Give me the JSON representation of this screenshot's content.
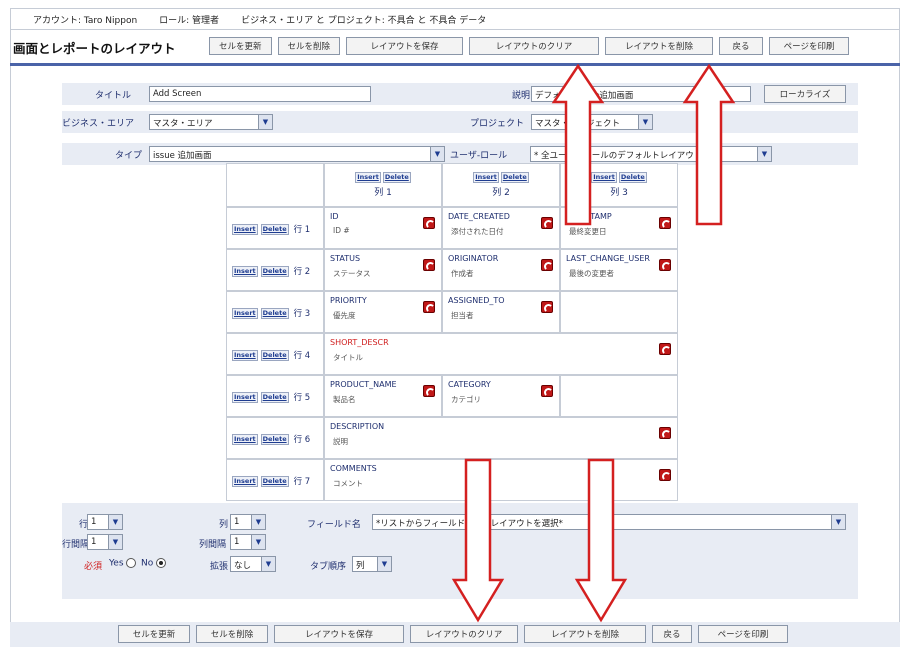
{
  "header": {
    "account": "アカウント: Taro Nippon",
    "role": "ロール: 管理者",
    "context": "ビジネス・エリア と プロジェクト: 不具合 と 不具合 データ"
  },
  "page_title": "画面とレポートのレイアウト",
  "top_buttons": [
    "セルを更新",
    "セルを削除",
    "レイアウトを保存",
    "レイアウトのクリア",
    "レイアウトを削除",
    "戻る",
    "ページを印刷"
  ],
  "form": {
    "title_label": "タイトル",
    "title_value": "Add Screen",
    "desc_label": "説明",
    "desc_value": "デフォルトissue追加画面",
    "localize_button": "ローカライズ",
    "business_area_label": "ビジネス・エリア",
    "business_area_value": "マスタ・エリア",
    "project_label": "プロジェクト",
    "project_value": "マスタ・プロジェクト",
    "type_label": "タイプ",
    "type_value": "issue 追加画面",
    "user_role_label": "ユーザ-ロール",
    "user_role_value": "* 全ユーザーロールのデフォルトレイアウト *"
  },
  "grid": {
    "insert_label": "Insert",
    "delete_label": "Delete",
    "columns": [
      "列 1",
      "列 2",
      "列 3"
    ],
    "rows": [
      {
        "label": "行 1",
        "cells": [
          {
            "name": "ID",
            "desc": "ID #"
          },
          {
            "name": "DATE_CREATED",
            "desc": "添付された日付"
          },
          {
            "name": "TIMESTAMP",
            "desc": "最終変更日"
          }
        ]
      },
      {
        "label": "行 2",
        "cells": [
          {
            "name": "STATUS",
            "desc": "ステータス"
          },
          {
            "name": "ORIGINATOR",
            "desc": "作成者"
          },
          {
            "name": "LAST_CHANGE_USER",
            "desc": "最後の変更者"
          }
        ]
      },
      {
        "label": "行 3",
        "cells": [
          {
            "name": "PRIORITY",
            "desc": "優先度"
          },
          {
            "name": "ASSIGNED_TO",
            "desc": "担当者"
          }
        ]
      },
      {
        "label": "行 4",
        "cells": [
          {
            "name": "SHORT_DESCR",
            "desc": "タイトル",
            "required": true
          }
        ]
      },
      {
        "label": "行 5",
        "cells": [
          {
            "name": "PRODUCT_NAME",
            "desc": "製品名"
          },
          {
            "name": "CATEGORY",
            "desc": "カテゴリ"
          }
        ]
      },
      {
        "label": "行 6",
        "cells": [
          {
            "name": "DESCRIPTION",
            "desc": "説明"
          }
        ]
      },
      {
        "label": "行 7",
        "cells": [
          {
            "name": "COMMENTS",
            "desc": "コメント"
          }
        ]
      }
    ]
  },
  "cell_editor": {
    "row_label": "行",
    "row_value": "1",
    "col_label": "列",
    "col_value": "1",
    "field_label": "フィールド名",
    "field_value": "*リストからフィールドまたはレイアウトを選択*",
    "row_span_label": "行間隔",
    "row_span_value": "1",
    "col_span_label": "列間隔",
    "col_span_value": "1",
    "required_label": "必須",
    "yes_label": "Yes",
    "no_label": "No",
    "extend_label": "拡張",
    "extend_value": "なし",
    "tab_order_label": "タブ順序",
    "tab_order_value": "列"
  },
  "bottom_buttons": [
    "セルを更新",
    "セルを削除",
    "レイアウトを保存",
    "レイアウトのクリア",
    "レイアウトを削除",
    "戻る",
    "ページを印刷"
  ],
  "colors": {
    "accent": "#4a63a8",
    "panel": "#e8ecf4",
    "label": "#1e2e6e",
    "arrow": "#d42020",
    "required": "#d02020"
  }
}
